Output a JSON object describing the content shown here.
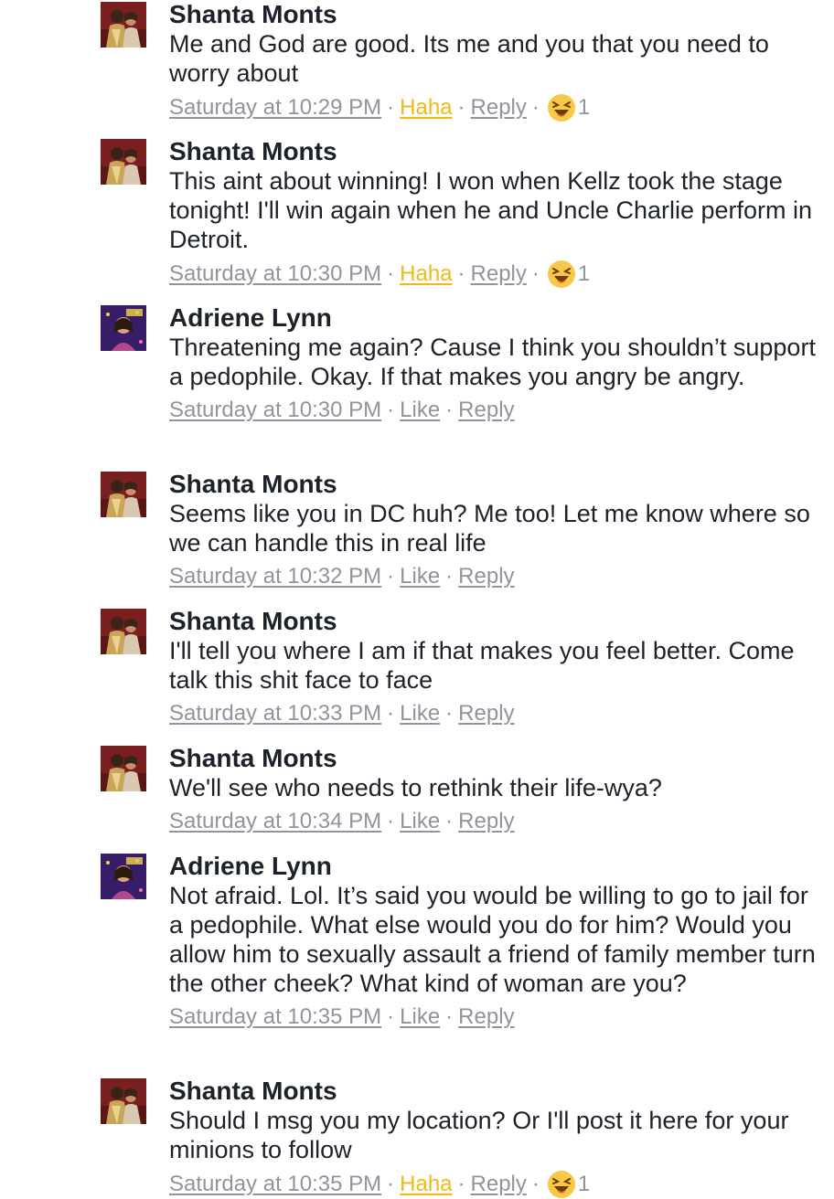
{
  "comments": [
    {
      "author": "Shanta Monts",
      "avatar": "shanta",
      "text": "Me and God are good. Its me and you that you need to worry about",
      "time": "Saturday at 10:29 PM",
      "action": "Haha",
      "reply": "Reply",
      "reaction_count": "1"
    },
    {
      "author": "Shanta Monts",
      "avatar": "shanta",
      "text": "This aint about winning! I won when Kellz took the stage tonight! I'll win again when he and Uncle Charlie perform in Detroit.",
      "time": "Saturday at 10:30 PM",
      "action": "Haha",
      "reply": "Reply",
      "reaction_count": "1"
    },
    {
      "author": "Adriene Lynn",
      "avatar": "adriene",
      "text": "Threatening me again? Cause I think you shouldn’t support a pedophile. Okay. If that makes you angry be angry.",
      "time": "Saturday at 10:30 PM",
      "action": "Like",
      "reply": "Reply"
    },
    {
      "author": "Shanta Monts",
      "avatar": "shanta",
      "text": "Seems like you in DC huh? Me too! Let me know where so we can handle this in real life",
      "time": "Saturday at 10:32 PM",
      "action": "Like",
      "reply": "Reply"
    },
    {
      "author": "Shanta Monts",
      "avatar": "shanta",
      "text": "I'll tell you where I am if that makes you feel better. Come talk this shit face to face",
      "time": "Saturday at 10:33 PM",
      "action": "Like",
      "reply": "Reply"
    },
    {
      "author": "Shanta Monts",
      "avatar": "shanta",
      "text": "We'll see who needs to rethink their life-wya?",
      "time": "Saturday at 10:34 PM",
      "action": "Like",
      "reply": "Reply"
    },
    {
      "author": "Adriene Lynn",
      "avatar": "adriene",
      "text": "Not afraid. Lol. It’s said you would be willing to go to jail for a pedophile. What else would you do for him? Would you allow him to sexually assault a friend of family member turn the other cheek? What kind of woman are you?",
      "time": "Saturday at 10:35 PM",
      "action": "Like",
      "reply": "Reply"
    },
    {
      "author": "Shanta Monts",
      "avatar": "shanta",
      "text": "Should I msg you my location? Or I'll post it here for your minions to follow",
      "time": "Saturday at 10:35 PM",
      "action": "Haha",
      "reply": "Reply",
      "reaction_count": "1"
    }
  ],
  "colors": {
    "text": "#1d2129",
    "meta": "#90949c",
    "haha": "#f0ba15"
  }
}
